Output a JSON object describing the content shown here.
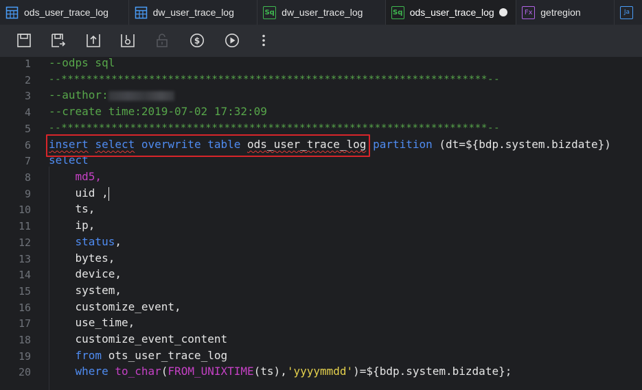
{
  "tabs": [
    {
      "label": "ods_user_trace_log",
      "icon": "table-icon",
      "active": false
    },
    {
      "label": "dw_user_trace_log",
      "icon": "table-icon",
      "active": false
    },
    {
      "label": "dw_user_trace_log",
      "icon": "sql-file-icon",
      "icon_text": "Sq",
      "active": false
    },
    {
      "label": "ods_user_trace_log",
      "icon": "sql-file-icon",
      "icon_text": "Sq",
      "active": true,
      "unsaved": true
    },
    {
      "label": "getregion",
      "icon": "function-icon",
      "icon_text": "Fx",
      "active": false
    },
    {
      "label": "",
      "icon": "java-file-icon",
      "icon_text": "Ja",
      "active": false
    }
  ],
  "toolbar": {
    "buttons": [
      "save-icon",
      "save-as-icon",
      "submit-icon",
      "publish-icon",
      "lock-icon",
      "cost-estimate-icon",
      "run-icon",
      "more-icon"
    ]
  },
  "editor": {
    "line_numbers": [
      "1",
      "2",
      "3",
      "4",
      "5",
      "6",
      "7",
      "8",
      "9",
      "10",
      "11",
      "12",
      "13",
      "14",
      "15",
      "16",
      "17",
      "18",
      "19",
      "20"
    ],
    "line1": "--odps sql",
    "line2": "--********************************************************************--",
    "line3": "--author:",
    "line4": "--create time:2019-07-02 17:32:09",
    "line5": "--********************************************************************--",
    "line6": {
      "insert": "insert",
      "select": "select",
      "overwrite": "overwrite",
      "table": "table",
      "table_name": "ods_user_trace_log",
      "partition": "partition",
      "rest": "(dt=${bdp.system.bizdate})"
    },
    "line7": "select",
    "line8": "md5,",
    "line9": "uid ,",
    "line10": "ts,",
    "line11": "ip,",
    "line12_kw": "status",
    "line12_punct": ",",
    "line13": "bytes,",
    "line14": "device,",
    "line15": "system,",
    "line16": "customize_event,",
    "line17": "use_time,",
    "line18": "customize_event_content",
    "line19_kw": "from",
    "line19_id": "ots_user_trace_log",
    "line20": {
      "where": "where",
      "to_char": "to_char",
      "open": "(",
      "from_unixtime": "FROM_UNIXTIME",
      "args": "(ts),",
      "fmt": "'yyyymmdd'",
      "rest": ")=${bdp.system.bizdate};"
    }
  },
  "colors": {
    "comment": "#57a64a",
    "keyword": "#4f8cf2",
    "function": "#c541c5",
    "string": "#e5d14d",
    "highlight_box": "#d9252a"
  }
}
